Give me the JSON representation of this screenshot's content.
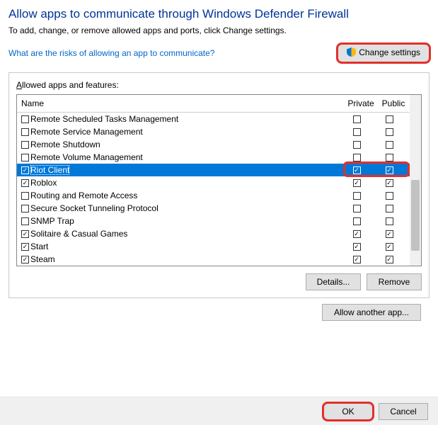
{
  "title": "Allow apps to communicate through Windows Defender Firewall",
  "subtitle": "To add, change, or remove allowed apps and ports, click Change settings.",
  "risk_link": "What are the risks of allowing an app to communicate?",
  "change_settings": "Change settings",
  "group_label_prefix": "A",
  "group_label_rest": "llowed apps and features:",
  "headers": {
    "name": "Name",
    "private": "Private",
    "public": "Public"
  },
  "apps": [
    {
      "label": "Remote Scheduled Tasks Management",
      "name_checked": false,
      "private": false,
      "public": false,
      "selected": false
    },
    {
      "label": "Remote Service Management",
      "name_checked": false,
      "private": false,
      "public": false,
      "selected": false
    },
    {
      "label": "Remote Shutdown",
      "name_checked": false,
      "private": false,
      "public": false,
      "selected": false
    },
    {
      "label": "Remote Volume Management",
      "name_checked": false,
      "private": false,
      "public": false,
      "selected": false
    },
    {
      "label": "Riot Client",
      "name_checked": true,
      "private": true,
      "public": true,
      "selected": true
    },
    {
      "label": "Roblox",
      "name_checked": true,
      "private": true,
      "public": true,
      "selected": false
    },
    {
      "label": "Routing and Remote Access",
      "name_checked": false,
      "private": false,
      "public": false,
      "selected": false
    },
    {
      "label": "Secure Socket Tunneling Protocol",
      "name_checked": false,
      "private": false,
      "public": false,
      "selected": false
    },
    {
      "label": "SNMP Trap",
      "name_checked": false,
      "private": false,
      "public": false,
      "selected": false
    },
    {
      "label": "Solitaire & Casual Games",
      "name_checked": true,
      "private": true,
      "public": true,
      "selected": false
    },
    {
      "label": "Start",
      "name_checked": true,
      "private": true,
      "public": true,
      "selected": false
    },
    {
      "label": "Steam",
      "name_checked": true,
      "private": true,
      "public": true,
      "selected": false
    }
  ],
  "buttons": {
    "details": "Details...",
    "remove": "Remove",
    "allow_another": "Allow another app...",
    "ok": "OK",
    "cancel": "Cancel"
  }
}
